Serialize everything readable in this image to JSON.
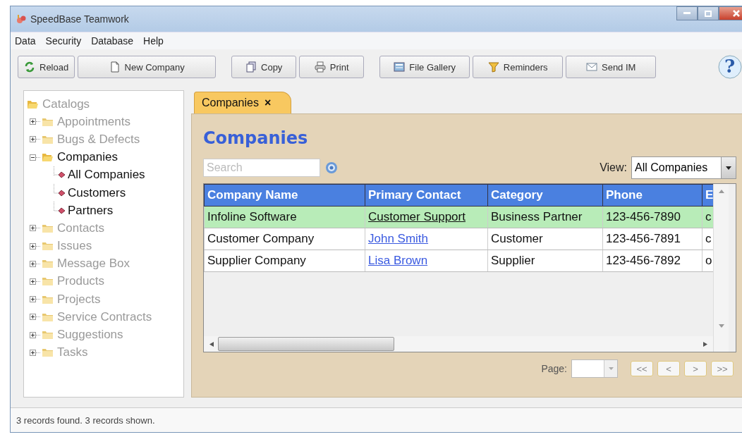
{
  "window": {
    "title": "SpeedBase Teamwork"
  },
  "menu": [
    "Data",
    "Security",
    "Database",
    "Help"
  ],
  "toolbar": {
    "groups": [
      [
        {
          "label": "Reload",
          "kind": "reload"
        },
        {
          "label": "New Company",
          "kind": "new"
        }
      ],
      [
        {
          "label": "Copy",
          "kind": "copy"
        },
        {
          "label": "Print",
          "kind": "print"
        }
      ],
      [
        {
          "label": "File Gallery",
          "kind": "gallery"
        },
        {
          "label": "Reminders",
          "kind": "reminders"
        },
        {
          "label": "Send IM",
          "kind": "message"
        }
      ]
    ],
    "help": "?"
  },
  "sidebar": {
    "tree": {
      "label": "Catalogs",
      "children": [
        {
          "label": "Appointments",
          "expanded": false,
          "disabled": true
        },
        {
          "label": "Bugs & Defects",
          "expanded": false,
          "disabled": true
        },
        {
          "label": "Companies",
          "expanded": true,
          "disabled": false,
          "children": [
            {
              "label": "All Companies"
            },
            {
              "label": "Customers"
            },
            {
              "label": "Partners"
            }
          ]
        },
        {
          "label": "Contacts",
          "expanded": false,
          "disabled": true
        },
        {
          "label": "Issues",
          "expanded": false,
          "disabled": true
        },
        {
          "label": "Message Box",
          "expanded": false,
          "disabled": true
        },
        {
          "label": "Products",
          "expanded": false,
          "disabled": true
        },
        {
          "label": "Projects",
          "expanded": false,
          "disabled": true
        },
        {
          "label": "Service Contracts",
          "expanded": false,
          "disabled": true
        },
        {
          "label": "Suggestions",
          "expanded": false,
          "disabled": true
        },
        {
          "label": "Tasks",
          "expanded": false,
          "disabled": true
        }
      ]
    }
  },
  "tabs": [
    {
      "label": "Companies",
      "close": "×",
      "selected": true
    }
  ],
  "heading": "Companies",
  "search": {
    "placeholder": "Search"
  },
  "view": {
    "label": "View:",
    "value": "All Companies"
  },
  "table": {
    "columns": [
      "Company Name",
      "Primary Contact",
      "Category",
      "Phone",
      "E"
    ],
    "rows": [
      {
        "selected": true,
        "cells": [
          "Infoline Software",
          "Customer Support",
          "Business Partner",
          "123-456-7890",
          "c"
        ]
      },
      {
        "selected": false,
        "cells": [
          "Customer Company",
          "John Smith",
          "Customer",
          "123-456-7891",
          "c"
        ]
      },
      {
        "selected": false,
        "cells": [
          "Supplier Company",
          "Lisa Brown",
          "Supplier",
          "123-456-7892",
          "o"
        ]
      }
    ]
  },
  "pager": {
    "label": "Page:",
    "buttons": [
      "<<",
      "<",
      ">",
      ">>"
    ]
  },
  "status_bar": "3 records found. 3 records shown."
}
